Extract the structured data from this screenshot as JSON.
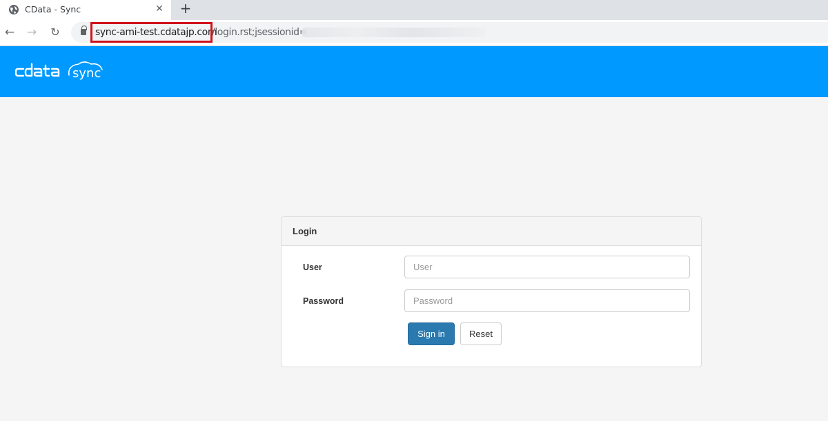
{
  "browser": {
    "tab_title": "CData - Sync",
    "tab_close": "✕",
    "new_tab": "+",
    "url_host": "sync-ami-test.cdatajp.com",
    "url_path": "/login.rst;jsessionid=",
    "highlight_color": "#d0121c"
  },
  "app": {
    "brand_color": "#0099ff",
    "logo_text": "cdata sync"
  },
  "login": {
    "heading": "Login",
    "user_label": "User",
    "user_placeholder": "User",
    "password_label": "Password",
    "password_placeholder": "Password",
    "sign_in": "Sign in",
    "reset": "Reset",
    "primary_color": "#2a7ab0"
  },
  "icons": [
    "globe-icon",
    "close-icon",
    "plus-icon",
    "back-icon",
    "forward-icon",
    "reload-icon",
    "lock-icon"
  ]
}
